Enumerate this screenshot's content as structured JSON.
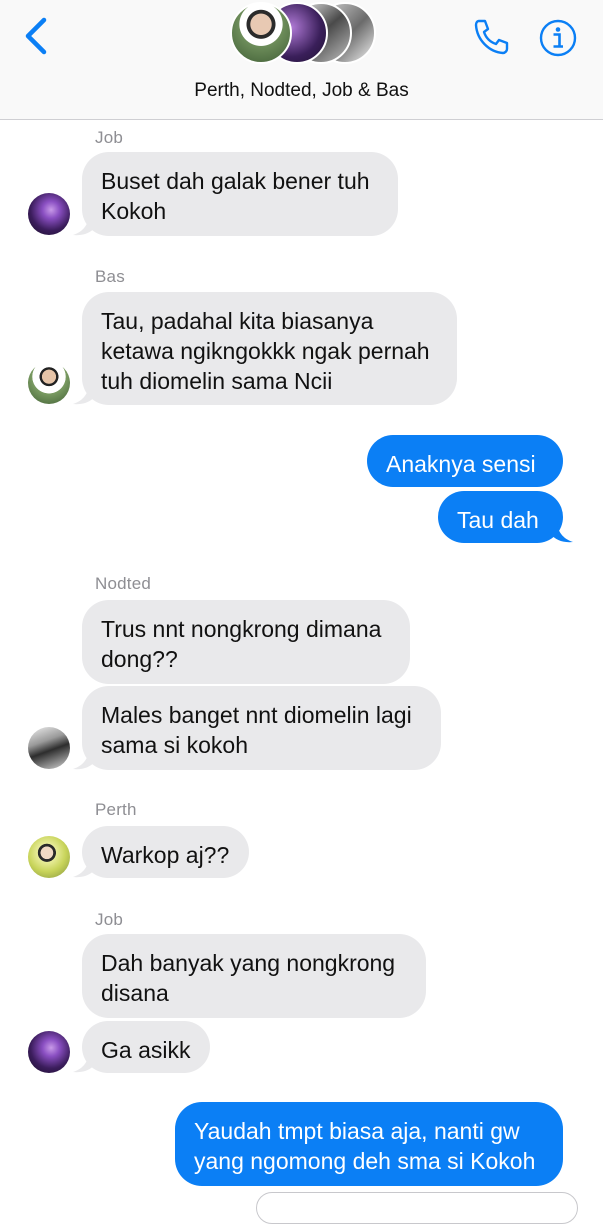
{
  "header": {
    "title": "Perth, Nodted, Job & Bas",
    "avatars": [
      "group-avatar-1",
      "group-avatar-2",
      "group-avatar-3",
      "group-avatar-4"
    ]
  },
  "colors": {
    "accent": "#0b7ff5",
    "incoming_bubble": "#e9e9eb",
    "sender_label": "#8e8e93"
  },
  "messages": [
    {
      "sender": "Job",
      "text": "Buset dah galak bener tuh Kokoh"
    },
    {
      "sender": "Bas",
      "text": "Tau, padahal kita biasanya ketawa ngikngokkk ngak pernah tuh diomelin sama Ncii"
    },
    {
      "text": "Anaknya sensi"
    },
    {
      "text": "Tau dah"
    },
    {
      "sender": "Nodted",
      "text": "Trus nnt nongkrong dimana dong??"
    },
    {
      "text": "Males banget nnt diomelin lagi sama si kokoh"
    },
    {
      "sender": "Perth",
      "text": "Warkop aj??"
    },
    {
      "sender": "Job",
      "text": "Dah banyak yang nongkrong disana"
    },
    {
      "text": "Ga asikk"
    },
    {
      "text": "Yaudah tmpt biasa aja, nanti gw yang ngomong deh sma si Kokoh"
    }
  ]
}
